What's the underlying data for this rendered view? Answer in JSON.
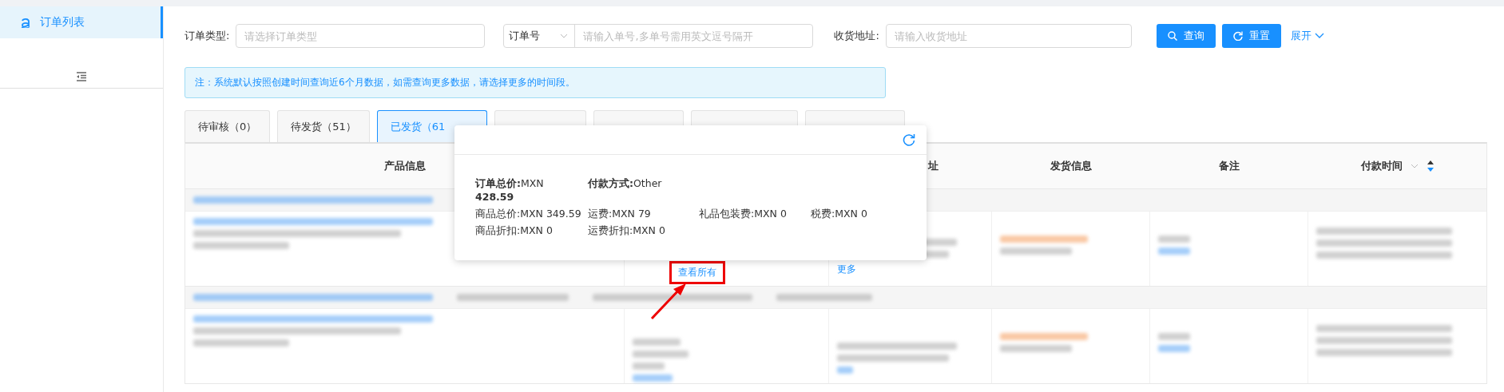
{
  "sidebar": {
    "items": [
      {
        "label": "订单列表",
        "selected": true
      }
    ]
  },
  "filters": [
    {
      "kind": "text",
      "label": "订单类型:",
      "placeholder": "请选择订单类型"
    },
    {
      "kind": "select-input",
      "select": "订单号",
      "placeholder": "请输入单号,多单号需用英文逗号隔开"
    },
    {
      "kind": "text",
      "label": "收货地址:",
      "placeholder": "请输入收货地址"
    }
  ],
  "buttons": [
    {
      "kind": "search",
      "label": "查询"
    },
    {
      "kind": "reset",
      "label": "重置"
    }
  ],
  "expand_link": "展开",
  "notice": "注：系统默认按照创建时间查询近6个月数据，如需查询更多数据，请选择更多的时间段。",
  "tabs": [
    {
      "label": "待审核（0）",
      "selected": false
    },
    {
      "label": "待发货（51）",
      "selected": false
    },
    {
      "label": "已发货（61",
      "selected": true
    },
    {
      "selected": false
    },
    {
      "selected": false
    },
    {
      "selected": false
    },
    {
      "selected": false
    }
  ],
  "table": {
    "columns": [
      {
        "label": "产品信息"
      },
      {},
      {
        "label": "址"
      },
      {
        "label": "发货信息"
      },
      {
        "label": "备注"
      },
      {
        "label": "付款时间",
        "sorted_descending": true
      }
    ],
    "rows": [
      {
        "more_link": "更多",
        "view_all_link": "查看所有",
        "highlighted": true
      },
      {}
    ]
  },
  "popover": {
    "rows": [
      [
        {
          "label": "订单总价:",
          "value": "MXN **428.59**",
          "emphasis": true
        },
        {
          "label": "付款方式:",
          "value": "Other",
          "emphasis": true
        }
      ],
      [
        {
          "label": "商品总价:",
          "value": "MXN 349.59",
          "emphasis": false
        },
        {
          "label": "运费:",
          "value": "MXN 79",
          "emphasis": false
        },
        {
          "label": "礼品包装费:",
          "value": "MXN 0",
          "emphasis": false
        },
        {
          "label": "税费:",
          "value": "MXN 0",
          "emphasis": false
        }
      ],
      [
        {
          "label": "商品折扣:",
          "value": "MXN 0",
          "emphasis": false
        },
        {
          "label": "运费折扣:",
          "value": "MXN 0",
          "emphasis": false
        }
      ]
    ]
  }
}
